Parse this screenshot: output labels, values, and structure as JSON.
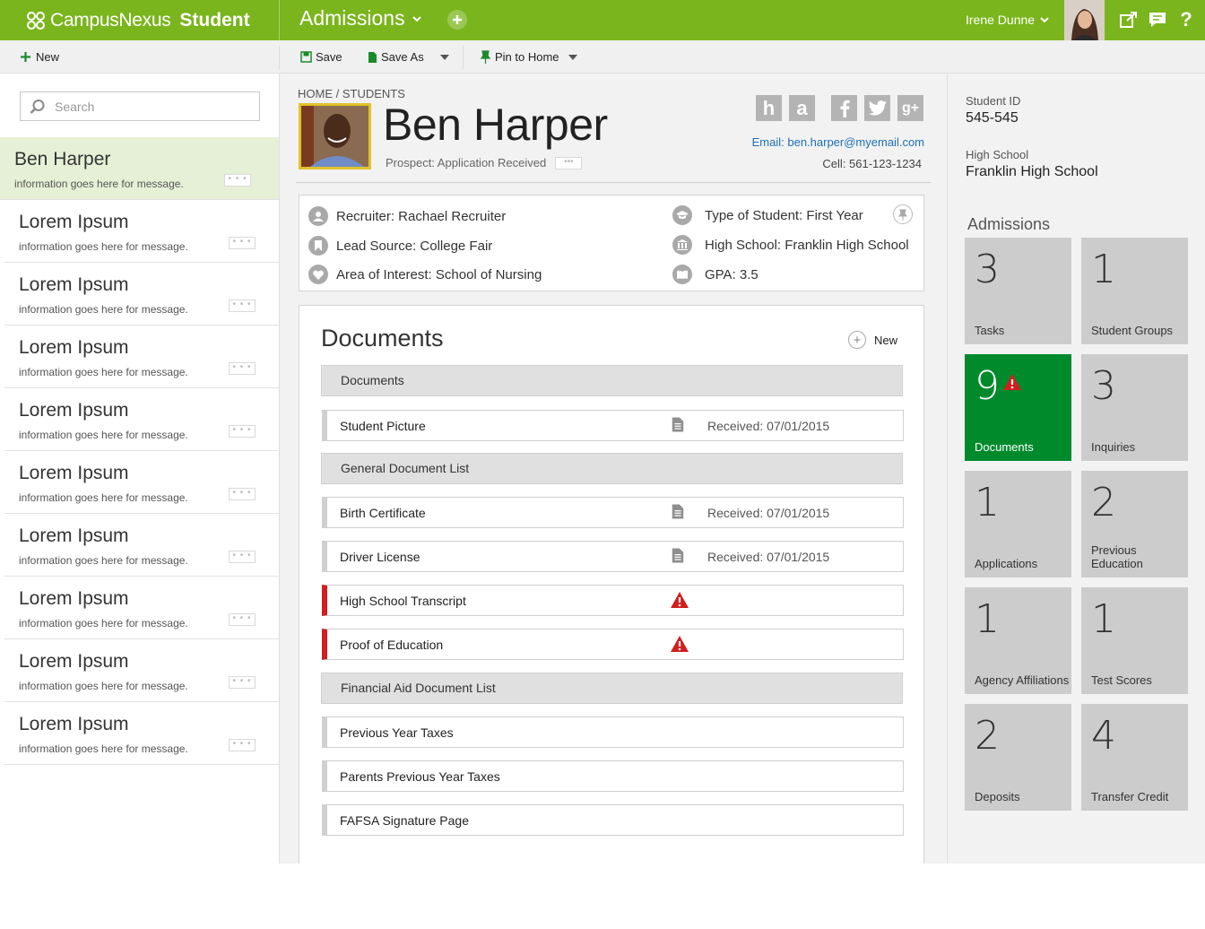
{
  "app": {
    "brand_light": "CampusNexus",
    "brand_bold": "Student",
    "module": "Admissions",
    "user_name": "Irene Dunne",
    "accent_color": "#7ab51d"
  },
  "toolbar": {
    "new_label": "New",
    "save_label": "Save",
    "save_as_label": "Save As",
    "pin_label": "Pin to Home"
  },
  "search": {
    "placeholder": "Search"
  },
  "list": [
    {
      "name": "Ben Harper",
      "info": "information goes here for message."
    },
    {
      "name": "Lorem Ipsum",
      "info": "information goes here for message."
    },
    {
      "name": "Lorem Ipsum",
      "info": "information goes here for message."
    },
    {
      "name": "Lorem Ipsum",
      "info": "information goes here for message."
    },
    {
      "name": "Lorem Ipsum",
      "info": "information goes here for message."
    },
    {
      "name": "Lorem Ipsum",
      "info": "information goes here for message."
    },
    {
      "name": "Lorem Ipsum",
      "info": "information goes here for message."
    },
    {
      "name": "Lorem Ipsum",
      "info": "information goes here for message."
    },
    {
      "name": "Lorem Ipsum",
      "info": "information goes here for message."
    },
    {
      "name": "Lorem Ipsum",
      "info": "information goes here for message."
    }
  ],
  "student": {
    "breadcrumb": "HOME / STUDENTS",
    "name": "Ben Harper",
    "status": "Prospect: Application Received",
    "email": "Email: ben.harper@myemail.com",
    "cell": "Cell: 561-123-1234",
    "social": [
      "h",
      "a"
    ]
  },
  "info": {
    "recruiter": "Recruiter: Rachael Recruiter",
    "lead_source": "Lead Source: College Fair",
    "interest": "Area of Interest: School of Nursing",
    "type": "Type of Student: First Year",
    "high_school": "High School: Franklin High School",
    "gpa": "GPA: 3.5"
  },
  "documents": {
    "title": "Documents",
    "new_label": "New",
    "sections": [
      {
        "title": "Documents",
        "rows": [
          {
            "name": "Student Picture",
            "received": "Received: 07/01/2015",
            "missing": false
          }
        ]
      },
      {
        "title": "General Document List",
        "rows": [
          {
            "name": "Birth Certificate",
            "received": "Received: 07/01/2015",
            "missing": false
          },
          {
            "name": "Driver License",
            "received": "Received: 07/01/2015",
            "missing": false
          },
          {
            "name": "High School Transcript",
            "received": "",
            "missing": true
          },
          {
            "name": "Proof of Education",
            "received": "",
            "missing": true
          }
        ]
      },
      {
        "title": "Financial Aid Document List",
        "rows": [
          {
            "name": "Previous Year Taxes",
            "received": "",
            "missing": false
          },
          {
            "name": "Parents Previous Year Taxes",
            "received": "",
            "missing": false
          },
          {
            "name": "FAFSA Signature Page",
            "received": "",
            "missing": false
          }
        ]
      }
    ]
  },
  "right": {
    "student_id_label": "Student ID",
    "student_id": "545-545",
    "high_school_label": "High School",
    "high_school": "Franklin High School",
    "admissions_title": "Admissions",
    "tiles": [
      {
        "num": "3",
        "label": "Tasks"
      },
      {
        "num": "1",
        "label": "Student Groups"
      },
      {
        "num": "9",
        "label": "Documents",
        "highlight": true
      },
      {
        "num": "3",
        "label": "Inquiries"
      },
      {
        "num": "1",
        "label": "Applications"
      },
      {
        "num": "2",
        "label": "Previous Education"
      },
      {
        "num": "1",
        "label": "Agency Affiliations"
      },
      {
        "num": "1",
        "label": "Test Scores"
      },
      {
        "num": "2",
        "label": "Deposits"
      },
      {
        "num": "4",
        "label": "Transfer Credit"
      }
    ]
  }
}
